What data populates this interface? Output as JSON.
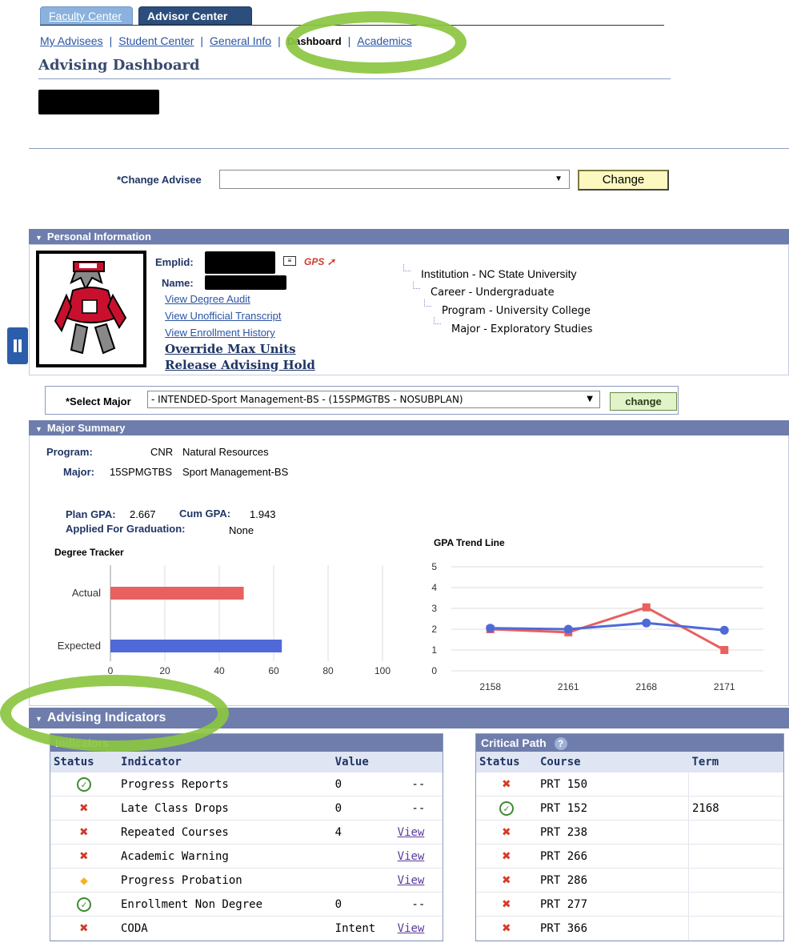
{
  "tabs": [
    {
      "label": "Faculty Center"
    },
    {
      "label": "Advisor Center"
    }
  ],
  "subnav": {
    "my_advisees": "My Advisees",
    "student_center": "Student Center",
    "general_info": "General Info",
    "dashboard": "Dashboard",
    "academics": "Academics"
  },
  "page_title": "Advising Dashboard",
  "change_advisee": {
    "label": "*Change Advisee",
    "value": "",
    "button": "Change"
  },
  "personal": {
    "header": "Personal Information",
    "emplid_label": "Emplid:",
    "name_label": "Name:",
    "gps_label": "GPS",
    "links": [
      "View Degree Audit",
      "View Unofficial Transcript",
      "View Enrollment History"
    ],
    "bold_links": [
      "Override Max Units",
      "Release Advising Hold"
    ],
    "tree": [
      "Institution - NC State University",
      "Career - Undergraduate",
      "Program - University College",
      "Major - Exploratory Studies"
    ]
  },
  "select_major": {
    "label": "*Select Major",
    "value": "- INTENDED-Sport Management-BS -  (15SPMGTBS - NOSUBPLAN)",
    "button": "change"
  },
  "major_summary": {
    "header": "Major Summary",
    "program_label": "Program:",
    "program_code": "CNR",
    "program_name": "Natural Resources",
    "major_label": "Major:",
    "major_code": "15SPMGTBS",
    "major_name": "Sport Management-BS",
    "plan_gpa_label": "Plan GPA:",
    "plan_gpa": "2.667",
    "cum_gpa_label": "Cum GPA:",
    "cum_gpa": "1.943",
    "applied_label": "Applied For Graduation:",
    "applied_value": "None"
  },
  "chart_data": [
    {
      "type": "bar",
      "title": "Degree Tracker",
      "categories": [
        "Actual",
        "Expected"
      ],
      "values": [
        49,
        63
      ],
      "xlim": [
        0,
        100
      ],
      "xticks": [
        "0",
        "20",
        "40",
        "60",
        "80",
        "100"
      ],
      "colors": [
        "#e86060",
        "#4f6ad8"
      ],
      "grid": true
    },
    {
      "type": "line",
      "title": "GPA Trend Line",
      "categories": [
        "2158",
        "2161",
        "2168",
        "2171"
      ],
      "ylim": [
        0,
        5
      ],
      "yticks": [
        "0",
        "1",
        "2",
        "3",
        "4",
        "5"
      ],
      "series": [
        {
          "values": [
            2.0,
            1.85,
            3.05,
            1.0
          ],
          "color": "#e86060",
          "marker": "square"
        },
        {
          "values": [
            2.05,
            2.0,
            2.3,
            1.95
          ],
          "color": "#4f6ad8",
          "marker": "circle"
        }
      ],
      "grid": true
    }
  ],
  "advising": {
    "header": "Advising Indicators",
    "indicators_title": "Indicators",
    "cols": [
      "Status",
      "Indicator",
      "Value",
      ""
    ],
    "rows": [
      {
        "status": "ok",
        "indicator": "Progress Reports",
        "value": "0",
        "action": "--"
      },
      {
        "status": "x",
        "indicator": "Late Class Drops",
        "value": "0",
        "action": "--"
      },
      {
        "status": "x",
        "indicator": "Repeated Courses",
        "value": "4",
        "action": "View"
      },
      {
        "status": "x",
        "indicator": "Academic Warning",
        "value": "",
        "action": "View"
      },
      {
        "status": "warn",
        "indicator": "Progress Probation",
        "value": "",
        "action": "View"
      },
      {
        "status": "ok",
        "indicator": "Enrollment Non Degree",
        "value": "0",
        "action": "--"
      },
      {
        "status": "x",
        "indicator": "CODA",
        "value": "Intent",
        "action": "View"
      }
    ],
    "critical_title": "Critical Path",
    "critical_cols": [
      "Status",
      "Course",
      "Term"
    ],
    "critical_rows": [
      {
        "status": "x",
        "course": "PRT 150",
        "term": ""
      },
      {
        "status": "ok",
        "course": "PRT 152",
        "term": "2168"
      },
      {
        "status": "x",
        "course": "PRT 238",
        "term": ""
      },
      {
        "status": "x",
        "course": "PRT 266",
        "term": ""
      },
      {
        "status": "x",
        "course": "PRT 286",
        "term": ""
      },
      {
        "status": "x",
        "course": "PRT 277",
        "term": ""
      },
      {
        "status": "x",
        "course": "PRT 366",
        "term": ""
      }
    ]
  }
}
